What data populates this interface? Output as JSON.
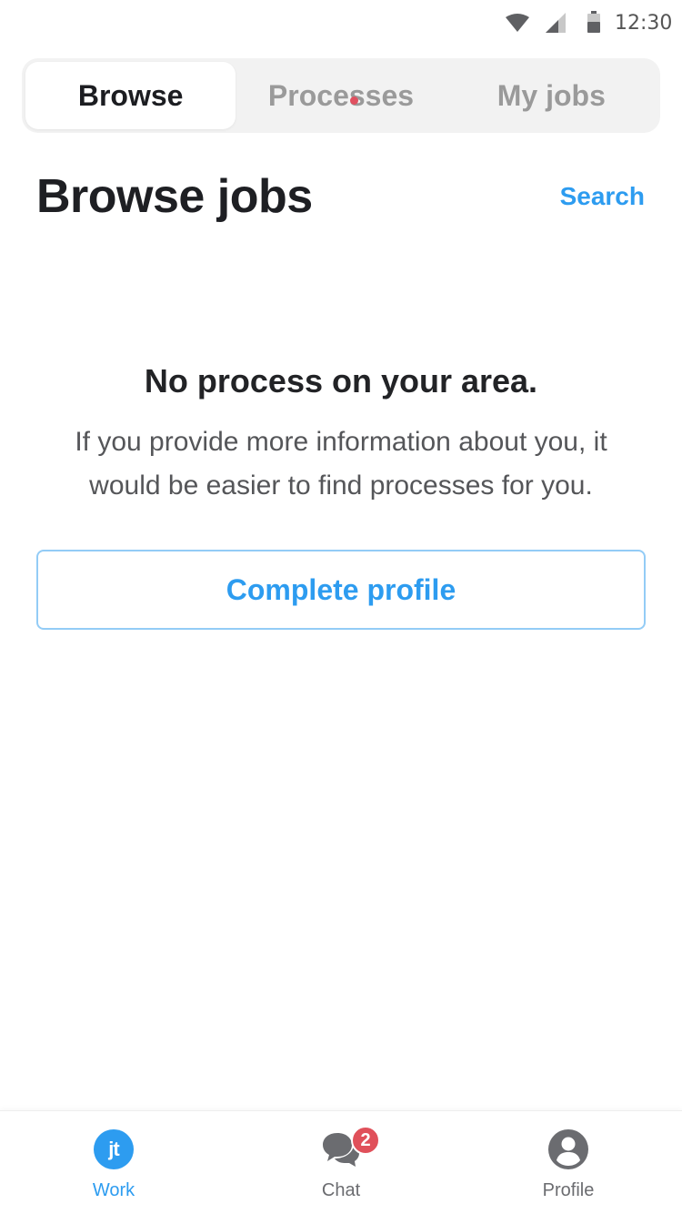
{
  "status_bar": {
    "time": "12:30",
    "icons": [
      "wifi-icon",
      "cell-signal-icon",
      "battery-icon"
    ]
  },
  "segmented_control": {
    "tabs": [
      {
        "label": "Browse",
        "active": true
      },
      {
        "label": "Processes",
        "active": false,
        "has_notification_dot": true
      },
      {
        "label": "My jobs",
        "active": false
      }
    ]
  },
  "header": {
    "title": "Browse jobs",
    "search_label": "Search"
  },
  "empty_state": {
    "title": "No process on your area.",
    "description": "If you provide more information about you, it would be easier to find processes for you.",
    "button_label": "Complete profile"
  },
  "tab_bar": {
    "items": [
      {
        "label": "Work",
        "icon": "jt-logo-icon",
        "active": true,
        "logo_text": "jt"
      },
      {
        "label": "Chat",
        "icon": "chat-bubbles-icon",
        "active": false,
        "badge": "2"
      },
      {
        "label": "Profile",
        "icon": "user-avatar-icon",
        "active": false
      }
    ]
  },
  "colors": {
    "accent": "#2d9cf0",
    "badge": "#e0505a",
    "segment_bg": "#f2f2f2",
    "text_primary": "#1e1f23",
    "text_muted": "#9a9a9a"
  }
}
